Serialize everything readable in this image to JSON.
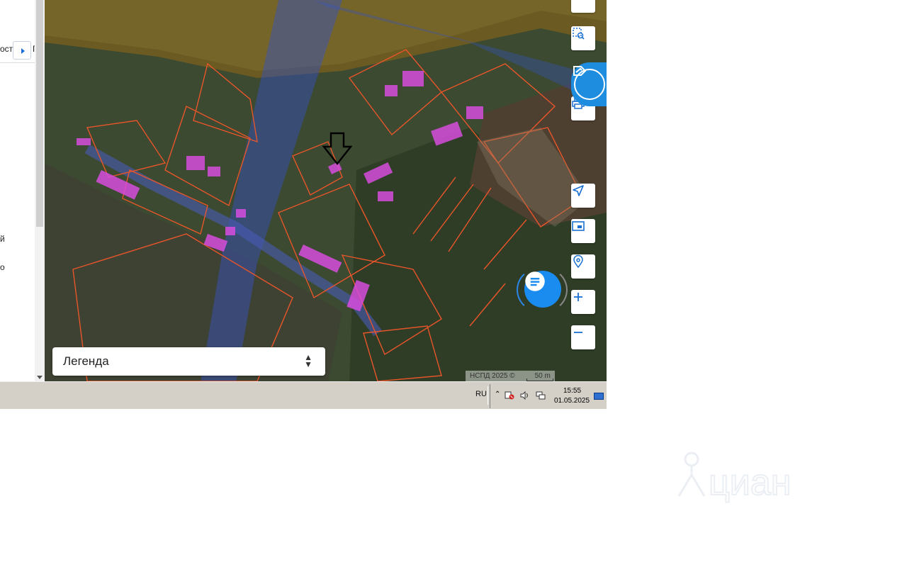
{
  "left_panel": {
    "fragment_top": "оста",
    "fragment_top_right": "Г",
    "fragment_mid": "й",
    "fragment_low": "о",
    "toggle_icon": "caret-right-icon"
  },
  "map": {
    "toolbar": [
      {
        "name": "ruler-tool",
        "icon": "ruler-icon"
      },
      {
        "name": "area-select-tool",
        "icon": "area-select-icon"
      },
      {
        "name": "print-tool",
        "icon": "printer-icon"
      },
      {
        "name": "locate-tool",
        "icon": "navigation-arrow-icon"
      },
      {
        "name": "minimap-tool",
        "icon": "minimap-icon"
      },
      {
        "name": "search-location-tool",
        "icon": "location-search-icon"
      },
      {
        "name": "zoom-in-button",
        "icon": "plus-icon"
      },
      {
        "name": "zoom-out-button",
        "icon": "minus-icon"
      }
    ],
    "legend": {
      "label": "Легенда"
    },
    "attribution": "НСПД 2025 ©",
    "scale_label": "50 m",
    "colors": {
      "parcel_border": "#e8552a",
      "building_fill": "#d84de0",
      "zone_fill": "#3552c8",
      "accent": "#1e8de0"
    }
  },
  "taskbar": {
    "lang": "RU",
    "time": "15:55",
    "date": "01.05.2025"
  },
  "watermark": {
    "text": "циан"
  }
}
